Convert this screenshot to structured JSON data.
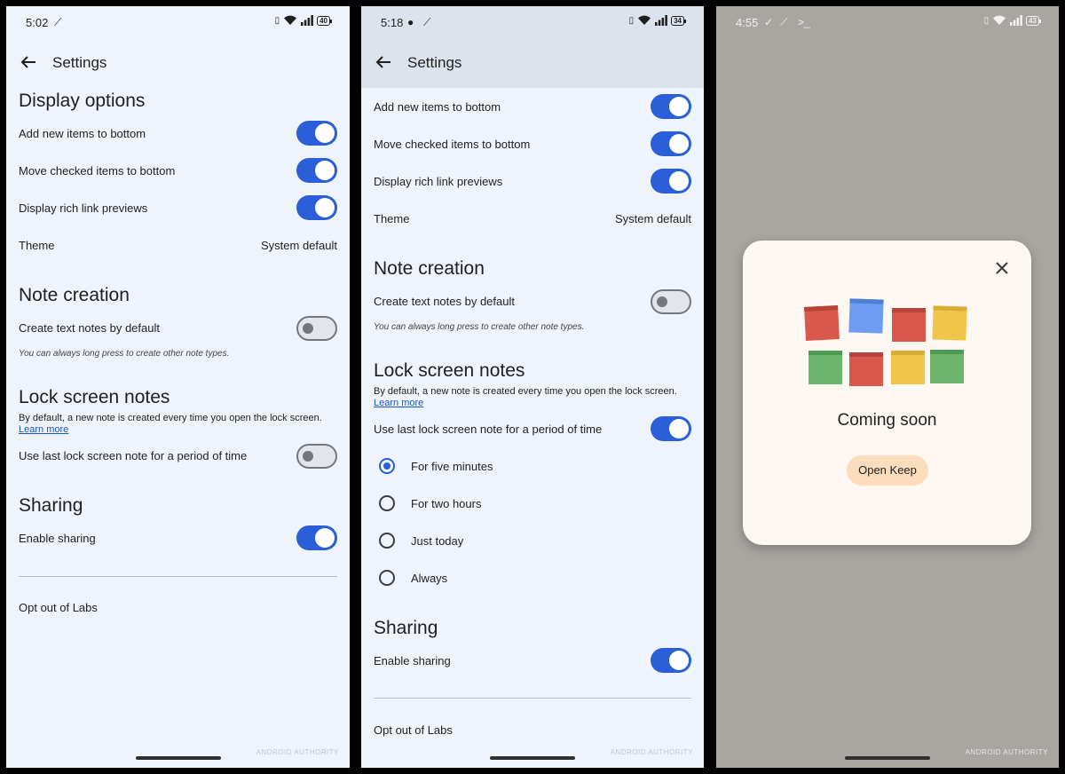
{
  "screen1": {
    "time": "5:02",
    "notif": "ᚽ",
    "battery": "40",
    "title": "Settings",
    "display_options": "Display options",
    "add_new_items": "Add new items to bottom",
    "move_checked": "Move checked items to bottom",
    "rich_links": "Display rich link previews",
    "theme_label": "Theme",
    "theme_value": "System default",
    "note_creation": "Note creation",
    "create_text_notes": "Create text notes by default",
    "note_hint": "You can always long press to create other note types.",
    "lock_screen_notes": "Lock screen notes",
    "lock_desc": "By default, a new note is created every time you open the lock screen.",
    "learn_more": "Learn more",
    "use_last_lock": "Use last lock screen note for a period of time",
    "sharing": "Sharing",
    "enable_sharing": "Enable sharing",
    "opt_out": "Opt out of Labs",
    "watermark": "ANDROID AUTHORITY"
  },
  "screen2": {
    "time": "5:18",
    "battery": "34",
    "title": "Settings",
    "add_new_items": "Add new items to bottom",
    "move_checked": "Move checked items to bottom",
    "rich_links": "Display rich link previews",
    "theme_label": "Theme",
    "theme_value": "System default",
    "note_creation": "Note creation",
    "create_text_notes": "Create text notes by default",
    "note_hint": "You can always long press to create other note types.",
    "lock_screen_notes": "Lock screen notes",
    "lock_desc": "By default, a new note is created every time you open the lock screen.",
    "learn_more": "Learn more",
    "use_last_lock": "Use last lock screen note for a period of time",
    "options": [
      "For five minutes",
      "For two hours",
      "Just today",
      "Always"
    ],
    "sharing": "Sharing",
    "enable_sharing": "Enable sharing",
    "opt_out": "Opt out of Labs",
    "watermark": "ANDROID AUTHORITY"
  },
  "screen3": {
    "time": "4:55",
    "battery": "43",
    "dialog_title": "Coming soon",
    "open_keep": "Open Keep",
    "watermark": "ANDROID AUTHORITY"
  },
  "colors": {
    "accent": "#2b5fd9",
    "background": "#eff3fb",
    "dialog_bg": "#fdf7f2",
    "button_bg": "#fbdcbc"
  }
}
